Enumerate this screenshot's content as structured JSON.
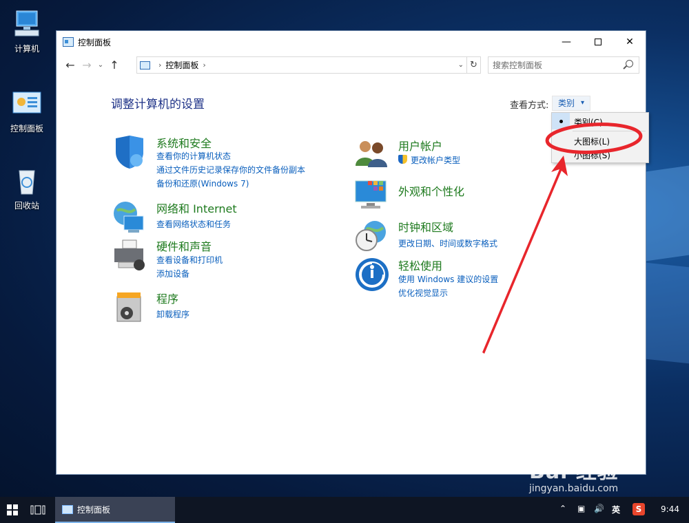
{
  "desktop": {
    "icons": [
      {
        "label": "计算机"
      },
      {
        "label": "控制面板"
      },
      {
        "label": "回收站"
      }
    ]
  },
  "window": {
    "title": "控制面板",
    "address": {
      "segment": "控制面板"
    },
    "search_placeholder": "搜索控制面板",
    "heading": "调整计算机的设置",
    "view_by_label": "查看方式:",
    "view_by_value": "类别",
    "menu": {
      "items": [
        {
          "label": "类别(C)",
          "selected": true
        },
        {
          "label": "大图标(L)",
          "selected": false
        },
        {
          "label": "小图标(S)",
          "selected": false
        }
      ]
    },
    "categories": {
      "system": {
        "title": "系统和安全",
        "links": [
          "查看你的计算机状态",
          "通过文件历史记录保存你的文件备份副本",
          "备份和还原(Windows 7)"
        ]
      },
      "network": {
        "title": "网络和 Internet",
        "links": [
          "查看网络状态和任务"
        ]
      },
      "hardware": {
        "title": "硬件和声音",
        "links": [
          "查看设备和打印机",
          "添加设备"
        ]
      },
      "programs": {
        "title": "程序",
        "links": [
          "卸载程序"
        ]
      },
      "users": {
        "title": "用户帐户",
        "links": [
          "更改帐户类型"
        ]
      },
      "appearance": {
        "title": "外观和个性化",
        "links": []
      },
      "clock": {
        "title": "时钟和区域",
        "links": [
          "更改日期、时间或数字格式"
        ]
      },
      "ease": {
        "title": "轻松使用",
        "links": [
          "使用 Windows 建议的设置",
          "优化视觉显示"
        ]
      }
    }
  },
  "taskbar": {
    "active_item": "控制面板",
    "ime": "英",
    "time": "9:44"
  },
  "watermark": {
    "brand": "Bai 经验",
    "url": "jingyan.baidu.com"
  },
  "colors": {
    "annotation": "#e8262c",
    "link": "#0a5fbd",
    "category_title": "#1e7a1e",
    "heading": "#1e3287"
  }
}
